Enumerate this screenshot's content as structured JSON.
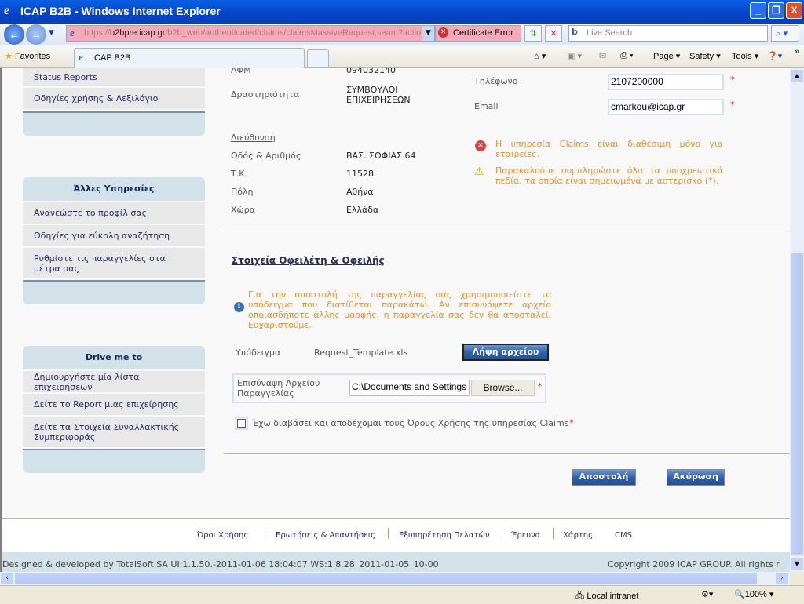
{
  "window": {
    "title": "ICAP B2B - Windows Internet Explorer",
    "minimize": "_",
    "restore": "❐",
    "close": "X"
  },
  "address": {
    "prefix": "https://",
    "host": "b2bpre.icap.gr",
    "path": "/b2b_web/authenticated/claims/claimsMassiveRequest.seam?actio",
    "cert_error": "Certificate Error",
    "search_placeholder": "Live Search"
  },
  "tabs": {
    "favorites": "Favorites",
    "active_tab": "ICAP B2B"
  },
  "toolbar": {
    "page": "Page",
    "safety": "Safety",
    "tools": "Tools"
  },
  "sidebar": {
    "group1": [
      "Status Reports",
      "Οδηγίες χρήσης & Λεξιλόγιο"
    ],
    "group2": {
      "title": "Άλλες Υπηρεσίες",
      "items": [
        "Ανανεώστε το προφίλ σας",
        "Οδηγίες για εύκολη αναζήτηση",
        "Ρυθμίστε τις παραγγελίες στα μέτρα σας"
      ]
    },
    "group3": {
      "title": "Drive me to",
      "items": [
        "Δημιουργήστε μία λίστα επιχειρήσεων",
        "Δείτε το Report μιας επιχείρησης",
        "Δείτε τα Στοιχεία Συναλλακτικής Συμπεριφοράς"
      ]
    }
  },
  "company": {
    "afm_label": "ΑΦΜ",
    "afm_value": "094032140",
    "activity_label": "Δραστηριότητα",
    "activity_value": "ΣΥΜΒΟΥΛΟΙ ΕΠΙΧΕΙΡΗΣΕΩΝ",
    "address_heading": "Διεύθυνση",
    "street_label": "Οδός & Αριθμός",
    "street_value": "ΒΑΣ. ΣΟΦΙΑΣ 64",
    "zip_label": "Τ.Κ.",
    "zip_value": "11528",
    "city_label": "Πόλη",
    "city_value": "Αθήνα",
    "country_label": "Χώρα",
    "country_value": "Ελλάδα",
    "phone_label": "Τηλέφωνο",
    "phone_value": "2107200000",
    "email_label": "Email",
    "email_value": "cmarkou@icap.gr",
    "required_mark": "*"
  },
  "messages": {
    "error": "Η υπηρεσία Claims είναι διαθέσιμη μόνο για εταιρείες.",
    "warning": "Παρακαλούμε συμπληρώστε όλα τα υποχρεωτικά πεδία, τα οποία είναι σημειωμένα με αστερίσκο (*).",
    "info": "Για την αποστολή της παραγγελίας σας χρησιμοποιείστε το υπόδειγμα που διατίθεται παρακάτω. Αν επισυνάψετε αρχείο οποιασδήποτε άλλης μορφής, η παραγγελία σας δεν θα αποσταλεί. Ευχαριστούμε."
  },
  "debtor": {
    "heading": "Στοιχεία Οφειλέτη & Οφειλής",
    "template_label": "Υπόδειγμα",
    "template_file": "Request_Template.xls",
    "download_button": "Λήψη αρχείου",
    "attach_label": "Επισύναψη Αρχείου Παραγγελίας",
    "attach_value": "C:\\Documents and Settings",
    "browse_button": "Browse...",
    "terms_text": "Έχω διαβάσει και αποδέχομαι τους Όρους Χρήσης της υπηρεσίας Claims",
    "terms_checked": false,
    "submit_button": "Αποστολή",
    "cancel_button": "Ακύρωση"
  },
  "footer": {
    "links": [
      "Όροι Χρήσης",
      "Ερωτήσεις & Απαντήσεις",
      "Εξυπηρέτηση Πελατών",
      "Έρευνα",
      "Χάρτης",
      "CMS"
    ],
    "designed": "Designed & developed by TotalSoft SA UI:1.1.50.-2011-01-06 18:04:07 WS:1.8.28_2011-01-05_10-00",
    "copyright": "Copyright 2009 ICAP GROUP. All rights r"
  },
  "statusbar": {
    "zone": "Local intranet",
    "zoom": "100%"
  }
}
